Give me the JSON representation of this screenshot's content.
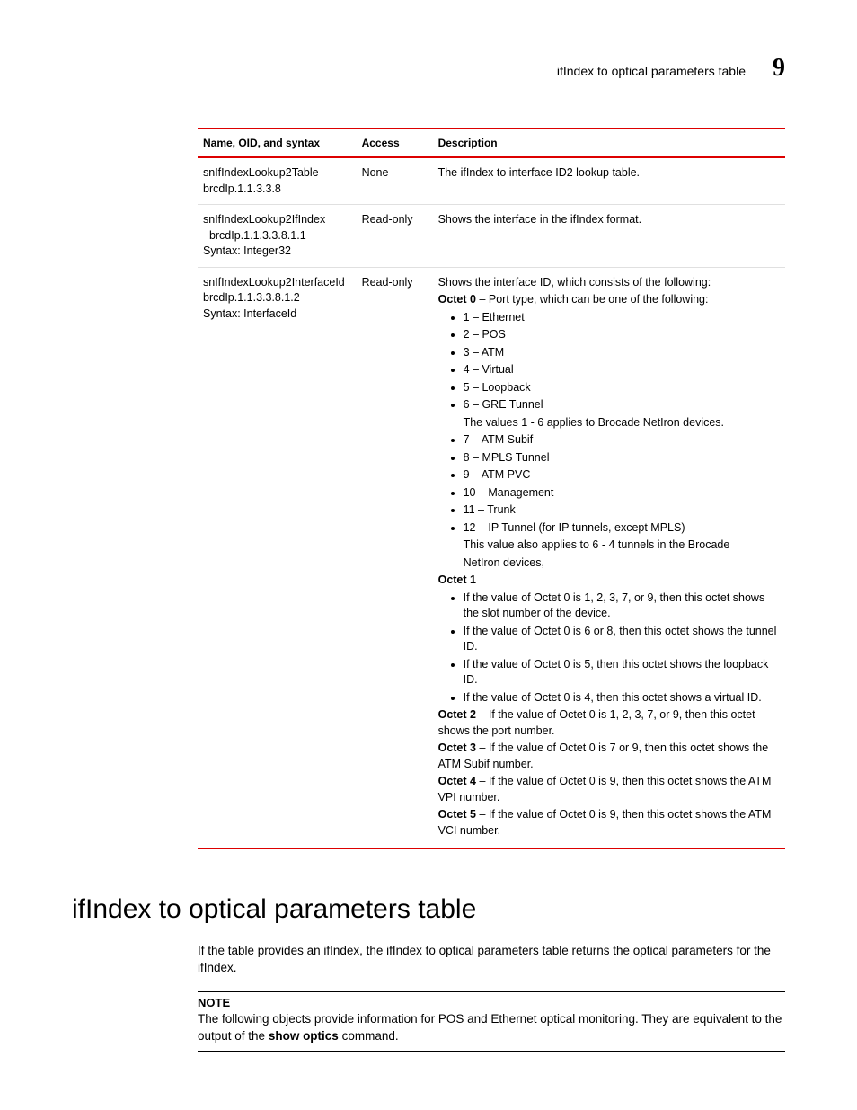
{
  "header": {
    "title": "ifIndex to optical parameters table",
    "chapter": "9"
  },
  "table": {
    "headers": {
      "name": "Name, OID, and syntax",
      "access": "Access",
      "desc": "Description"
    },
    "rows": [
      {
        "name_l1": "snIfIndexLookup2Table",
        "name_l2": "brcdIp.1.1.3.3.8",
        "name_l3": "",
        "access": "None",
        "desc_simple": "The ifIndex to interface ID2 lookup table."
      },
      {
        "name_l1": "snIfIndexLookup2IfIndex",
        "name_l2": "  brcdIp.1.1.3.3.8.1.1",
        "name_l3": "Syntax: Integer32",
        "access": "Read-only",
        "desc_simple": "Shows the interface in the ifIndex format."
      },
      {
        "name_l1": "snIfIndexLookup2InterfaceId",
        "name_l2": "brcdIp.1.1.3.3.8.1.2",
        "name_l3": "Syntax: InterfaceId",
        "access": "Read-only",
        "desc_complex": {
          "intro": "Shows the interface ID, which consists of the following:",
          "oct0_label": "Octet 0",
          "oct0_tail": " – Port type, which can be one of the following:",
          "oct0_list1": [
            "1 – Ethernet",
            "2 – POS",
            "3 – ATM",
            "4 – Virtual",
            "5 – Loopback",
            "6 – GRE Tunnel"
          ],
          "oct0_note1": "The values 1 - 6 applies to Brocade NetIron devices.",
          "oct0_list2": [
            "7 – ATM Subif",
            "8 – MPLS Tunnel",
            "9 – ATM PVC",
            "10 – Management",
            "11 – Trunk",
            "12 – IP Tunnel (for IP tunnels, except MPLS)"
          ],
          "oct0_note2a": "This value also applies to 6 - 4 tunnels in the Brocade",
          "oct0_note2b": "NetIron devices,",
          "oct1_label": "Octet 1",
          "oct1_list": [
            "If the value of Octet 0 is 1, 2, 3, 7, or 9, then this octet shows the slot number of the device.",
            "If the value of Octet 0 is 6 or 8, then this octet shows the tunnel ID.",
            "If the value of Octet 0 is 5, then this octet shows the loopback ID.",
            "If the value of Octet 0 is 4, then this octet shows a virtual ID."
          ],
          "oct2_label": "Octet 2",
          "oct2_tail": " – If the value of Octet 0 is 1, 2, 3, 7, or 9, then this octet shows the port number.",
          "oct3_label": "Octet 3",
          "oct3_tail": " – If the value of Octet 0 is 7 or 9, then this octet shows the ATM Subif number.",
          "oct4_label": "Octet 4",
          "oct4_tail": " – If the value of Octet 0 is 9, then this octet shows the ATM VPI number.",
          "oct5_label": "Octet 5",
          "oct5_tail": " – If the value of Octet 0 is 9, then this octet shows the ATM VCI number."
        }
      }
    ]
  },
  "section": {
    "heading": "ifIndex to optical parameters table",
    "para": "If the table provides an ifIndex, the ifIndex to optical parameters table returns the optical parameters for the ifIndex.",
    "note_title": "NOTE",
    "note_body_pre": "The following objects provide information for POS and Ethernet optical monitoring. They are equivalent to the output of the ",
    "note_body_bold": "show optics",
    "note_body_post": " command."
  }
}
